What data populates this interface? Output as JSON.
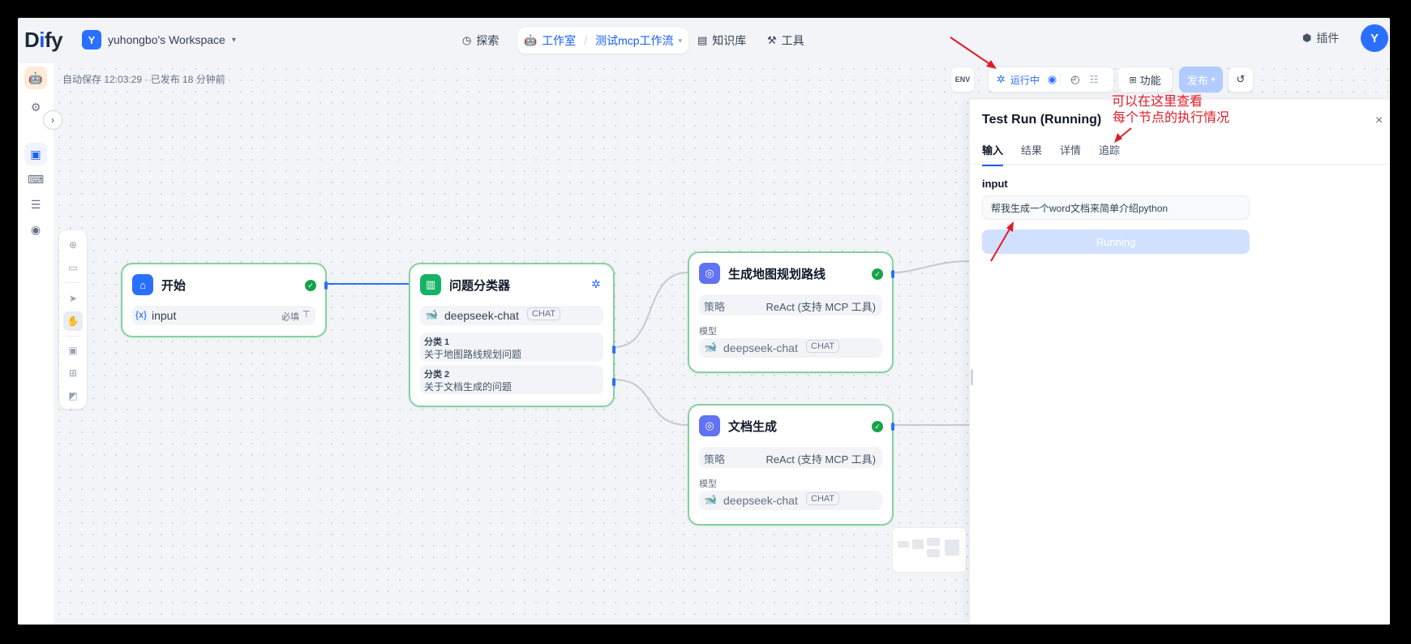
{
  "app": {
    "logo_prefix": "D",
    "logo_i": "i",
    "logo_suffix": "fy",
    "workspace_initial": "Y",
    "workspace_name": "yuhongbo's Workspace",
    "user_initial": "Y"
  },
  "nav": {
    "explore": "探索",
    "studio": "工作室",
    "current_app": "测试mcp工作流",
    "knowledge": "知识库",
    "tools": "工具",
    "plugins": "插件"
  },
  "canvas": {
    "autosave": "自动保存 12:03:29 · 已发布 18 分钟前"
  },
  "controls": {
    "env": "ENV",
    "running": "运行中",
    "features": "功能",
    "publish": "发布"
  },
  "nodes": {
    "start": {
      "title": "开始",
      "var_symbol": "{x}",
      "var_name": "input",
      "required": "必填"
    },
    "classifier": {
      "title": "问题分类器",
      "model": "deepseek-chat",
      "model_tag": "CHAT",
      "class1_label": "分类 1",
      "class1_text": "关于地图路线规划问题",
      "class2_label": "分类 2",
      "class2_text": "关于文档生成的问题"
    },
    "map_agent": {
      "title": "生成地图规划路线",
      "strategy_label": "策略",
      "strategy_value": "ReAct (支持 MCP 工具)",
      "model_label": "模型",
      "model": "deepseek-chat",
      "model_tag": "CHAT"
    },
    "doc_agent": {
      "title": "文档生成",
      "strategy_label": "策略",
      "strategy_value": "ReAct (支持 MCP 工具)",
      "model_label": "模型",
      "model": "deepseek-chat",
      "model_tag": "CHAT"
    }
  },
  "panel": {
    "title": "Test Run (Running)",
    "tabs": [
      "输入",
      "结果",
      "详情",
      "追踪"
    ],
    "input_label": "input",
    "input_value": "帮我生成一个word文档来简单介绍python",
    "run_button": "Running"
  },
  "annotations": {
    "line1": "可以在这里查看",
    "line2": "每个节点的执行情况"
  },
  "colors": {
    "accent": "#155eef",
    "node_border": "#85d1a2",
    "success": "#16a34a",
    "annotation": "#e11d2a"
  }
}
